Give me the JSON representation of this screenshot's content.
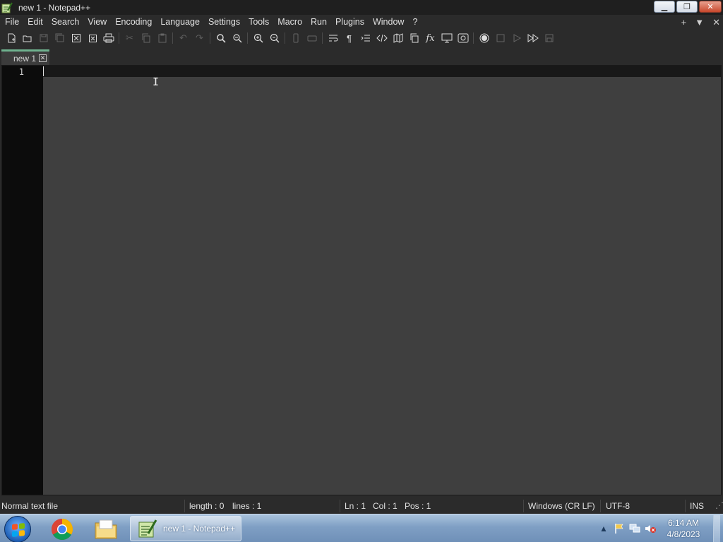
{
  "window": {
    "title": "new 1 - Notepad++",
    "app_icon": "notepadpp-icon"
  },
  "menu": {
    "items": [
      "File",
      "Edit",
      "Search",
      "View",
      "Encoding",
      "Language",
      "Settings",
      "Tools",
      "Macro",
      "Run",
      "Plugins",
      "Window",
      "?"
    ],
    "right_controls": [
      "+",
      "▼",
      "✕"
    ]
  },
  "toolbar": {
    "icons": [
      "new-file-icon",
      "open-file-icon",
      "save-icon",
      "save-all-icon",
      "close-icon",
      "close-all-icon",
      "print-icon",
      "cut-icon",
      "copy-icon",
      "paste-icon",
      "undo-icon",
      "redo-icon",
      "find-icon",
      "replace-icon",
      "zoom-in-icon",
      "zoom-out-icon",
      "sync-vertical-icon",
      "sync-horizontal-icon",
      "word-wrap-icon",
      "show-all-chars-icon",
      "indent-guide-icon",
      "xml-tag-icon",
      "document-map-icon",
      "document-list-icon",
      "function-list-icon",
      "folder-as-workspace-icon",
      "monitoring-icon",
      "macro-record-icon",
      "macro-stop-icon",
      "macro-play-icon",
      "macro-run-multiple-icon",
      "macro-save-icon"
    ]
  },
  "tabs": [
    {
      "label": "new 1",
      "active": true
    }
  ],
  "editor": {
    "line_numbers": [
      "1"
    ],
    "content": ""
  },
  "status": {
    "file_type": "Normal text file",
    "length": "length : 0",
    "lines": "lines : 1",
    "ln": "Ln : 1",
    "col": "Col : 1",
    "pos": "Pos : 1",
    "eol": "Windows (CR LF)",
    "encoding": "UTF-8",
    "mode": "INS"
  },
  "taskbar": {
    "pinned": [
      "chrome-icon",
      "file-explorer-icon"
    ],
    "active_task": "new 1 - Notepad++",
    "time": "6:14 AM",
    "date": "4/8/2023"
  },
  "colors": {
    "tab_accent": "#6fb28f",
    "editor_bg": "#3f3f3f",
    "gutter_bg": "#0c0c0c"
  }
}
